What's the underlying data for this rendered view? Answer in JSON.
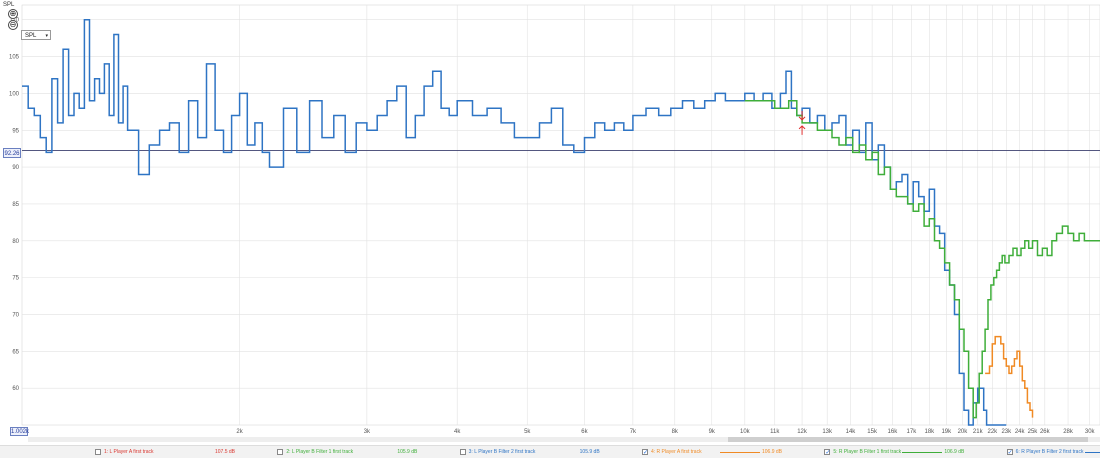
{
  "chart_data": {
    "type": "line",
    "title": "",
    "xlabel": "",
    "ylabel": "SPL",
    "x_scale": "log",
    "xlim": [
      1000,
      31000
    ],
    "ylim": [
      55,
      112
    ],
    "grid": true,
    "y_ticks": [
      {
        "value": 110,
        "label": "110"
      },
      {
        "value": 105,
        "label": "105"
      },
      {
        "value": 100,
        "label": "100"
      },
      {
        "value": 95,
        "label": "95"
      },
      {
        "value": 90,
        "label": "90"
      },
      {
        "value": 85,
        "label": "85"
      },
      {
        "value": 80,
        "label": "80"
      },
      {
        "value": 75,
        "label": "75"
      },
      {
        "value": 70,
        "label": "70"
      },
      {
        "value": 65,
        "label": "65"
      },
      {
        "value": 60,
        "label": "60"
      }
    ],
    "x_ticks": [
      {
        "value": 2000,
        "label": "2k"
      },
      {
        "value": 3000,
        "label": "3k"
      },
      {
        "value": 4000,
        "label": "4k"
      },
      {
        "value": 5000,
        "label": "5k"
      },
      {
        "value": 6000,
        "label": "6k"
      },
      {
        "value": 7000,
        "label": "7k"
      },
      {
        "value": 8000,
        "label": "8k"
      },
      {
        "value": 9000,
        "label": "9k"
      },
      {
        "value": 10000,
        "label": "10k"
      },
      {
        "value": 11000,
        "label": "11k"
      },
      {
        "value": 12000,
        "label": "12k"
      },
      {
        "value": 13000,
        "label": "13k"
      },
      {
        "value": 14000,
        "label": "14k"
      },
      {
        "value": 15000,
        "label": "15k"
      },
      {
        "value": 16000,
        "label": "16k"
      },
      {
        "value": 17000,
        "label": "17k"
      },
      {
        "value": 18000,
        "label": "18k"
      },
      {
        "value": 19000,
        "label": "19k"
      },
      {
        "value": 20000,
        "label": "20k"
      },
      {
        "value": 21000,
        "label": "21k"
      },
      {
        "value": 22000,
        "label": "22k"
      },
      {
        "value": 23000,
        "label": "23k"
      },
      {
        "value": 24000,
        "label": "24k"
      },
      {
        "value": 25000,
        "label": "25k"
      },
      {
        "value": 26000,
        "label": "26k"
      },
      {
        "value": 28000,
        "label": "28k"
      },
      {
        "value": 30000,
        "label": "30k"
      }
    ],
    "reference_line": {
      "value": 92.26,
      "label": "92.26"
    },
    "x_start_label": "1.002k",
    "series": [
      {
        "name": "6: R Player B Filter 2 first track",
        "color": "#2e74c4",
        "x": [
          1000,
          1020,
          1040,
          1060,
          1080,
          1100,
          1120,
          1140,
          1160,
          1180,
          1200,
          1220,
          1240,
          1260,
          1280,
          1300,
          1320,
          1340,
          1360,
          1380,
          1400,
          1450,
          1500,
          1550,
          1600,
          1650,
          1700,
          1750,
          1800,
          1850,
          1900,
          1950,
          2000,
          2050,
          2100,
          2150,
          2200,
          2300,
          2400,
          2500,
          2600,
          2700,
          2800,
          2900,
          3000,
          3100,
          3200,
          3300,
          3400,
          3500,
          3600,
          3700,
          3800,
          3900,
          4000,
          4200,
          4400,
          4600,
          4800,
          5000,
          5200,
          5400,
          5600,
          5800,
          6000,
          6200,
          6400,
          6600,
          6800,
          7000,
          7300,
          7600,
          7900,
          8200,
          8500,
          8800,
          9100,
          9400,
          9700,
          10000,
          10300,
          10600,
          10900,
          11200,
          11400,
          11600,
          11800,
          12000,
          12300,
          12600,
          12900,
          13200,
          13500,
          13800,
          14100,
          14400,
          14700,
          15000,
          15300,
          15600,
          15900,
          16200,
          16500,
          16800,
          17100,
          17400,
          17700,
          18000,
          18300,
          18600,
          18900,
          19200,
          19500,
          19800,
          20100,
          20400,
          20700,
          21000,
          21200,
          21400,
          21600,
          21800,
          22000,
          22200,
          22400,
          22600,
          22800,
          23000
        ],
        "y": [
          101,
          98,
          97,
          94,
          92,
          102,
          96,
          106,
          97,
          100,
          98,
          110,
          99,
          102,
          100,
          104,
          97,
          108,
          96,
          101,
          95,
          89,
          93,
          95,
          96,
          92,
          99,
          94,
          104,
          95,
          92,
          97,
          100,
          93,
          96,
          92,
          90,
          98,
          92,
          99,
          94,
          97,
          92,
          96,
          95,
          97,
          99,
          101,
          94,
          97,
          101,
          103,
          98,
          97,
          99,
          97,
          98,
          96,
          94,
          94,
          96,
          98,
          93,
          92,
          94,
          96,
          95,
          96,
          95,
          97,
          98,
          97,
          98,
          99,
          98,
          99,
          100,
          99,
          99,
          100,
          99,
          100,
          98,
          100,
          103,
          98,
          97,
          98,
          96,
          97,
          95,
          96,
          97,
          93,
          95,
          92,
          96,
          91,
          93,
          90,
          87,
          88,
          89,
          85,
          88,
          86,
          84,
          87,
          82,
          81,
          76,
          74,
          70,
          62,
          57,
          55,
          58,
          60,
          60,
          57,
          55,
          55,
          55,
          55,
          55,
          55,
          55,
          55
        ]
      },
      {
        "name": "5: R Player B Filter 1 first track",
        "color": "#3fae3a",
        "x": [
          10000,
          10500,
          11000,
          11500,
          11800,
          12000,
          12300,
          12600,
          12900,
          13200,
          13500,
          13800,
          14100,
          14400,
          14700,
          15000,
          15300,
          15600,
          15900,
          16200,
          16500,
          16800,
          17100,
          17400,
          17700,
          18000,
          18300,
          18600,
          18900,
          19200,
          19500,
          19800,
          20100,
          20400,
          20700,
          20900,
          21100,
          21300,
          21500,
          21700,
          21900,
          22100,
          22300,
          22500,
          22700,
          22900,
          23200,
          23500,
          23800,
          24100,
          24400,
          24700,
          25000,
          25400,
          25800,
          26200,
          26600,
          27000,
          27500,
          28000,
          28500,
          29000,
          29500,
          30000,
          30500,
          31000
        ],
        "y": [
          99,
          99,
          98,
          99,
          97,
          96,
          96,
          95,
          95,
          94,
          93,
          94,
          92,
          93,
          91,
          92,
          89,
          90,
          87,
          86,
          86,
          85,
          84,
          85,
          82,
          83,
          80,
          79,
          77,
          74,
          72,
          68,
          65,
          60,
          56,
          58,
          62,
          65,
          68,
          72,
          74,
          75,
          76,
          77,
          78,
          77,
          78,
          79,
          78,
          79,
          80,
          79,
          80,
          78,
          79,
          78,
          80,
          81,
          82,
          81,
          80,
          81,
          80,
          80,
          80,
          80
        ]
      },
      {
        "name": "4: R Player A first track",
        "color": "#f08a24",
        "x": [
          21500,
          21800,
          22000,
          22200,
          22400,
          22600,
          22800,
          23000,
          23200,
          23400,
          23600,
          23800,
          24000,
          24200,
          24400,
          24600,
          24800,
          25000
        ],
        "y": [
          62,
          63,
          66,
          67,
          67,
          66,
          64,
          63,
          62,
          63,
          64,
          65,
          63,
          61,
          60,
          58,
          57,
          56
        ]
      }
    ],
    "legend": [
      {
        "label": "1: L Player A first track",
        "value": "107.5 dB",
        "checked": false,
        "color": "#d9362f",
        "line": false
      },
      {
        "label": "2: L Player B Filter 1 first track",
        "value": "105.9 dB",
        "checked": false,
        "color": "#3fae3a",
        "line": false
      },
      {
        "label": "3: L Player B Filter 2 first track",
        "value": "105.9 dB",
        "checked": false,
        "color": "#2e74c4",
        "line": false
      },
      {
        "label": "4: R Player A first track",
        "value": "106.9 dB",
        "checked": true,
        "color": "#f08a24",
        "line": true
      },
      {
        "label": "5: R Player B Filter 1 first track",
        "value": "106.9 dB",
        "checked": true,
        "color": "#3fae3a",
        "line": true
      },
      {
        "label": "6: R Player B Filter 2 first track",
        "value": "107.0 dB",
        "checked": true,
        "color": "#2e74c4",
        "line": true
      }
    ]
  },
  "controls": {
    "zoom_in": "⊕",
    "zoom_out": "⊖",
    "yaxis_select": "SPL",
    "caret": "▾"
  }
}
